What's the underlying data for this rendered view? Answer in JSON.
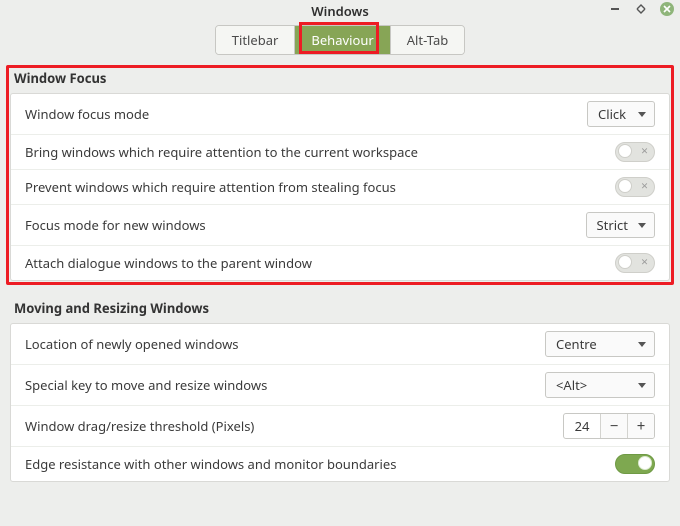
{
  "window": {
    "title": "Windows"
  },
  "tabs": {
    "titlebar": "Titlebar",
    "behaviour": "Behaviour",
    "alttab": "Alt-Tab",
    "active": "behaviour"
  },
  "focus": {
    "section_title": "Window Focus",
    "mode_label": "Window focus mode",
    "mode_value": "Click",
    "bring_label": "Bring windows which require attention to the current workspace",
    "bring_on": false,
    "prevent_label": "Prevent windows which require attention from stealing focus",
    "prevent_on": false,
    "newfocus_label": "Focus mode for new windows",
    "newfocus_value": "Strict",
    "attach_label": "Attach dialogue windows to the parent window",
    "attach_on": false
  },
  "move": {
    "section_title": "Moving and Resizing Windows",
    "location_label": "Location of newly opened windows",
    "location_value": "Centre",
    "special_label": "Special key to move and resize windows",
    "special_value": "<Alt>",
    "threshold_label": "Window drag/resize threshold (Pixels)",
    "threshold_value": "24",
    "edge_label": "Edge resistance with other windows and monitor boundaries",
    "edge_on": true
  }
}
